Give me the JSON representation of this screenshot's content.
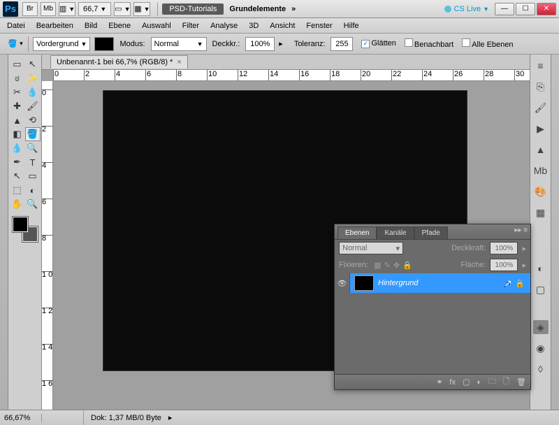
{
  "titlebar": {
    "ps": "Ps",
    "br": "Br",
    "mb": "Mb",
    "zoom": "66,7",
    "workspace": "PSD-Tutorials",
    "preset": "Grundelemente",
    "cslive": "CS Live"
  },
  "menu": [
    "Datei",
    "Bearbeiten",
    "Bild",
    "Ebene",
    "Auswahl",
    "Filter",
    "Analyse",
    "3D",
    "Ansicht",
    "Fenster",
    "Hilfe"
  ],
  "options": {
    "vg_label": "Vordergrund",
    "modus_label": "Modus:",
    "modus_value": "Normal",
    "deck_label": "Deckkr.:",
    "deck_value": "100%",
    "toleranz_label": "Toleranz:",
    "toleranz_value": "255",
    "glatten": "Glätten",
    "benachbart": "Benachbart",
    "alleebenen": "Alle Ebenen",
    "glatten_checked": "✓"
  },
  "doc": {
    "tab": "Unbenannt-1 bei 66,7% (RGB/8) *"
  },
  "ruler_h": [
    "0",
    "2",
    "4",
    "6",
    "8",
    "10",
    "12",
    "14",
    "16",
    "18",
    "20",
    "22",
    "24",
    "26",
    "28",
    "30"
  ],
  "ruler_v": [
    "0",
    "2",
    "4",
    "6",
    "8",
    "1\n0",
    "1\n2",
    "1\n4",
    "1\n6"
  ],
  "status": {
    "zoom": "66,67%",
    "dok": "Dok: 1,37 MB/0 Byte"
  },
  "layers": {
    "tabs": [
      "Ebenen",
      "Kanäle",
      "Pfade"
    ],
    "blend": "Normal",
    "deck_label": "Deckkraft:",
    "deck_value": "100%",
    "fix_label": "Fixieren:",
    "flache_label": "Fläche:",
    "flache_value": "100%",
    "layer_name": "Hintergrund"
  }
}
